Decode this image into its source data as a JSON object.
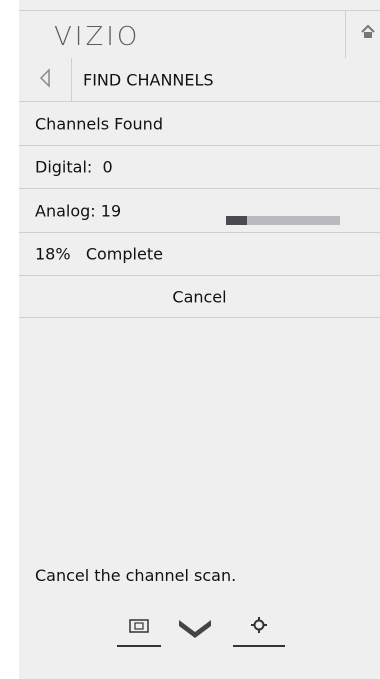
{
  "header": {
    "logo_text": "VIZIO",
    "home_icon": "home-icon"
  },
  "menu": {
    "back_icon": "back-arrow-icon",
    "title": "FIND CHANNELS"
  },
  "status": {
    "channels_found_label": "Channels Found",
    "digital_label": "Digital:  0",
    "analog_label": "Analog: 19",
    "progress_fraction": 0.18,
    "percent_label": "18%   Complete"
  },
  "actions": {
    "cancel_label": "Cancel"
  },
  "help": {
    "text": "Cancel the channel scan."
  },
  "bottom_nav": {
    "icons": [
      "picture-size-icon",
      "chevron-down-icon",
      "settings-gear-icon"
    ]
  },
  "colors": {
    "panel_bg": "#efefef",
    "divider": "#cfcfcf",
    "progress_fill": "#4a4a4f",
    "progress_track": "#b9b9bf",
    "text": "#111111"
  }
}
